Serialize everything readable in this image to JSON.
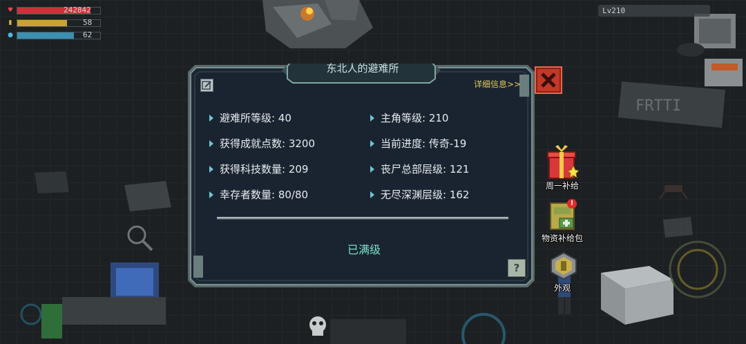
{
  "hud": {
    "health_value": "242842",
    "energy_value": "58",
    "water_value": "62",
    "health_level": 0.88,
    "energy_level": 0.6,
    "water_level": 0.68,
    "level_badge": "Lv210"
  },
  "dialog": {
    "title": "东北人的避难所",
    "detail_link": "详细信息>>",
    "stats_left": [
      {
        "label": "避难所等级: 40"
      },
      {
        "label": "获得成就点数: 3200"
      },
      {
        "label": "获得科技数量: 209"
      },
      {
        "label": "幸存者数量: 80/80"
      }
    ],
    "stats_right": [
      {
        "label": "主角等级: 210"
      },
      {
        "label": "当前进度: 传奇-19"
      },
      {
        "label": "丧尸总部层级: 121"
      },
      {
        "label": "无尽深渊层级: 162"
      }
    ],
    "status": "已满级",
    "help_glyph": "?"
  },
  "side_menu": {
    "weekly_gift": "周一补给",
    "supply_pack": "物资补给包",
    "supply_badge": "!",
    "appearance": "外观"
  },
  "colors": {
    "panel_bg": "#1c2733",
    "panel_border": "#4f6a70",
    "accent_teal": "#7ee0c8",
    "link_yellow": "#e3c85d",
    "close_red": "#c0392b"
  },
  "icons": [
    "heart-icon",
    "energy-icon",
    "water-icon",
    "edit-icon",
    "close-icon",
    "help-icon",
    "gift-icon",
    "supply-box-icon",
    "appearance-icon",
    "skull-icon",
    "magnifier-icon"
  ]
}
